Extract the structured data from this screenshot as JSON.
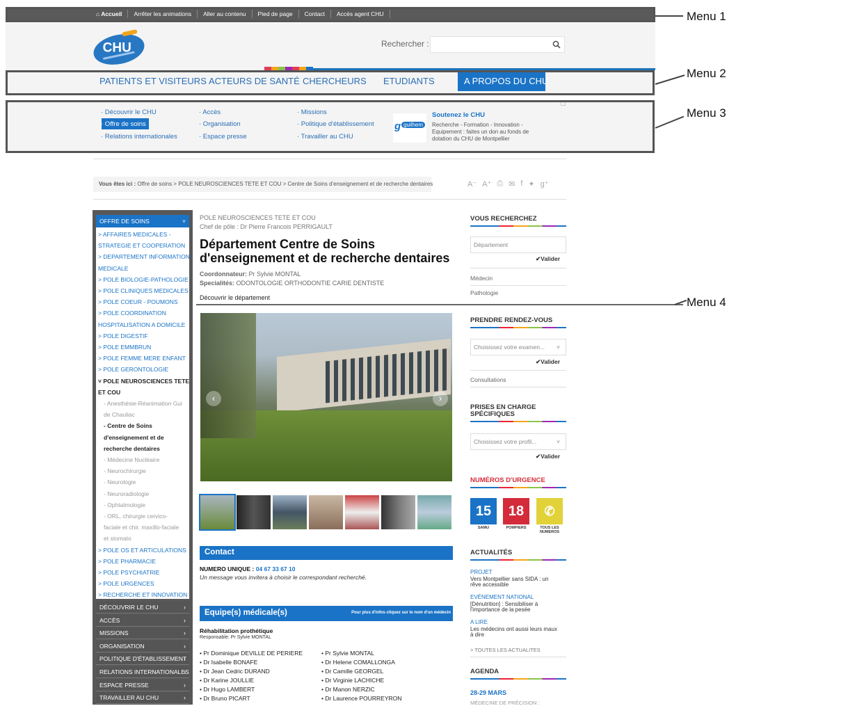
{
  "topbar": {
    "items": [
      "Accueil",
      "Arrêter les animations",
      "Aller au contenu",
      "Pied de page",
      "Contact",
      "Accès agent CHU"
    ]
  },
  "header": {
    "logo_text": "CHU",
    "search_label": "Rechercher :"
  },
  "menu2": {
    "items": [
      "PATIENTS ET VISITEURS",
      "ACTEURS DE SANTÉ",
      "CHERCHEURS",
      "ETUDIANTS",
      "A PROPOS DU CHU"
    ]
  },
  "menu3": {
    "col1": [
      "· Découvrir le CHU",
      "· Offre de soins",
      "· Relations internationales"
    ],
    "col2": [
      "· Accès",
      "· Organisation",
      "· Espace presse"
    ],
    "col3": [
      "· Missions",
      "· Politique d'établissement",
      "· Travailler au CHU"
    ],
    "promo_logo": "guilhem",
    "promo_title": "Soutenez le CHU",
    "promo_text_1": "Recherche - Formation - Innovation -",
    "promo_text_2": "Equipement : faites un don au fonds de",
    "promo_text_3": "dotation du CHU de Montpellier"
  },
  "annotations": [
    "Menu 1",
    "Menu 2",
    "Menu 3",
    "Menu 4"
  ],
  "breadcrumb": {
    "prefix": "Vous êtes ici :",
    "path": " Offre de soins  > POLE NEUROSCIENCES TETE ET COU  > Centre de Soins d'enseignement et de recherche dentaires"
  },
  "share_icons": [
    "text-smaller-icon",
    "text-larger-icon",
    "print-icon",
    "email-icon",
    "facebook-icon",
    "twitter-icon",
    "google-plus-icon"
  ],
  "leftnav": {
    "head": "OFFRE DE SOINS",
    "items": [
      "> AFFAIRES MEDICALES -",
      "   STRATEGIE ET COOPERATION",
      "> DEPARTEMENT INFORMATION",
      "   MEDICALE",
      "> POLE BIOLOGIE-PATHOLOGIE",
      "> POLE CLINIQUES MEDICALES",
      "> POLE COEUR - POUMONS",
      "> POLE COORDINATION",
      "   HOSPITALISATION A DOMICILE",
      "> POLE DIGESTIF",
      "> POLE EMMBRUN",
      "> POLE FEMME MERE ENFANT",
      "> POLE GERONTOLOGIE"
    ],
    "active_1": "˅ POLE NEUROSCIENCES TETE",
    "active_2": "   ET COU",
    "subs": [
      "- Anesthésie-Réanimation Gui",
      "de Chauliac"
    ],
    "current": [
      "- Centre de Soins",
      "d'enseignement et de",
      "recherche dentaires"
    ],
    "subs2": [
      "- Médecine Nucléaire",
      "- Neurochirurgie",
      "- Neurologie",
      "- Neuroradiologie",
      "- Ophtalmologie",
      "- ORL, chirurgie cervico-",
      "faciale et chir. maxillo-faciale",
      "et stomato"
    ],
    "items2": [
      "> POLE OS ET ARTICULATIONS",
      "> POLE PHARMACIE",
      "> POLE PSYCHIATRIE",
      "> POLE URGENCES",
      "> RECHERCHE ET INNOVATION"
    ],
    "dark": [
      "DÉCOUVRIR LE CHU",
      "ACCÈS",
      "MISSIONS",
      "ORGANISATION",
      "POLITIQUE D'ÉTABLISSEMENT",
      "RELATIONS INTERNATIONALES",
      "ESPACE PRESSE",
      "TRAVAILLER AU CHU"
    ]
  },
  "main": {
    "pole": "POLE NEUROSCIENCES TETE ET COU",
    "chef": "Chef de pôle : Dr Pierre Francois PERRIGAULT",
    "title_1": "Département Centre de Soins",
    "title_2": "d'enseignement et de recherche dentaires",
    "coord_label": "Coordonnateur:",
    "coord_value": " Pr Sylvie MONTAL",
    "spec_label": "Specialités:",
    "spec_value": " ODONTOLOGIE ORTHODONTIE CARIE DENTISTE",
    "discover": "Découvrir le département",
    "contact_title": "Contact",
    "numero_label": "NUMERO UNIQUE :",
    "numero_value": " 04 67 33 67 10",
    "numero_note": "Un message vous invitera à choisir le correspondant recherché.",
    "equipe_title": "Equipe(s) médicale(s)",
    "equipe_hint": "Pour plus d'infos cliquez sur le nom d'un médecin",
    "equipe_name": "Réhabilitation prothétique",
    "equipe_resp": "Responsable: Pr Sylvie MONTAL",
    "doctors_left": [
      "• Pr Dominique DEVILLE DE PERIERE",
      "• Dr Isabelle BONAFE",
      "• Dr Jean Cedric DURAND",
      "• Dr Karine JOULLIE",
      "• Dr Hugo LAMBERT",
      "• Dr Bruno PICART"
    ],
    "doctors_right": [
      "• Pr Sylvie MONTAL",
      "• Dr Helene COMALLONGA",
      "• Dr Camille GEORGEL",
      "• Dr Virginie LACHICHE",
      "• Dr Manon NERZIC",
      "• Dr Laurence POURREYRON"
    ]
  },
  "right": {
    "search_title": "VOUS RECHERCHEZ",
    "search_placeholder": "Département",
    "valider": "Valider",
    "medecin": "Médecin",
    "pathologie": "Pathologie",
    "rdv_title": "PRENDRE RENDEZ-VOUS",
    "rdv_select": "Choisissez votre examen...",
    "consultations": "Consultations",
    "prises_1": "PRISES EN CHARGE",
    "prises_2": "SPÉCIFIQUES",
    "prises_select": "Choisissez votre profil...",
    "urgence_title": "NUMÉROS D'URGENCE",
    "urg_samu": "15",
    "urg_pompiers": "18",
    "urg_samu_lbl": "SAMU",
    "urg_pompiers_lbl": "POMPIERS",
    "urg_tous_lbl_1": "TOUS LES",
    "urg_tous_lbl_2": "NUMEROS",
    "actu_title": "ACTUALITÉS",
    "news": [
      {
        "cat": "PROJET",
        "l1": "Vers Montpellier sans SIDA : un",
        "l2": "rêve accessible"
      },
      {
        "cat": "EVÉNEMENT NATIONAL",
        "l1": "[Dénutrition] : Sensibiliser à",
        "l2": "l'importance de la pesée"
      },
      {
        "cat": "A LIRE",
        "l1": "Les médecins ont aussi leurs maux",
        "l2": "à dire"
      }
    ],
    "all_news": "> TOUTES LES ACTUALITES",
    "agenda_title": "AGENDA",
    "agenda_date": "28-29 MARS",
    "agenda_text": "MÉDECINE DE PRÉCISION :"
  },
  "colors": {
    "blue": "#1a73c6",
    "urg_red": "#d42b3a",
    "urg_yellow": "#e1d23a",
    "urg_blue": "#1a73c6"
  }
}
